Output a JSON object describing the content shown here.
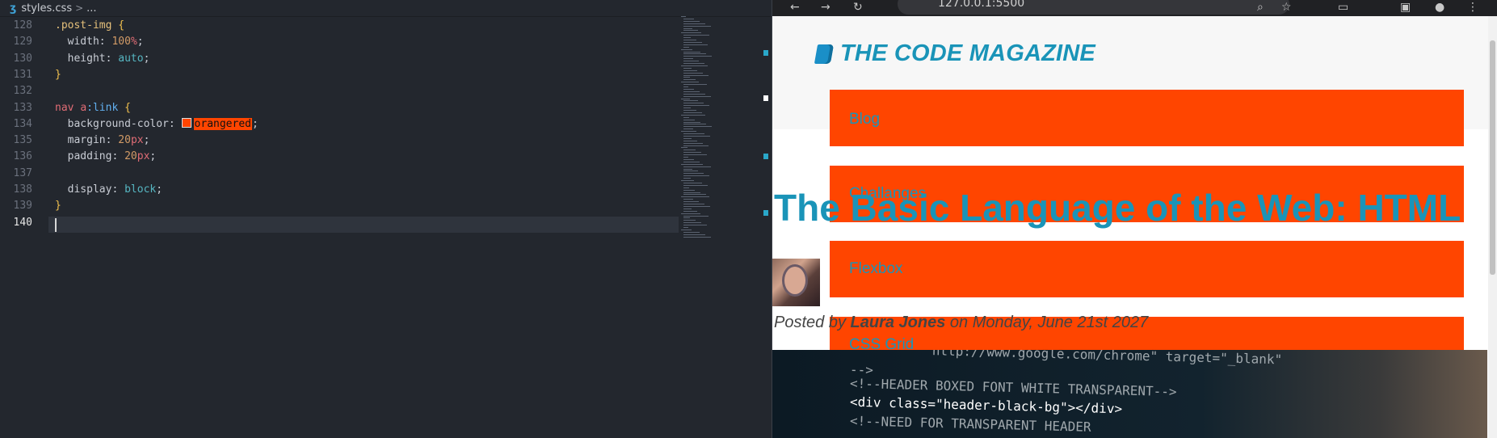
{
  "editor": {
    "breadcrumb": {
      "file": "styles.css",
      "more": "..."
    },
    "lines": [
      {
        "num": "128",
        "parts": [
          {
            "t": ".post-img",
            "c": "sel"
          },
          {
            "t": " ",
            "c": ""
          },
          {
            "t": "{",
            "c": "brace"
          }
        ]
      },
      {
        "num": "129",
        "parts": [
          {
            "t": "  width: ",
            "c": "prop"
          },
          {
            "t": "100",
            "c": "num"
          },
          {
            "t": "%",
            "c": "unit"
          },
          {
            "t": ";",
            "c": "prop"
          }
        ]
      },
      {
        "num": "130",
        "parts": [
          {
            "t": "  height: ",
            "c": "prop"
          },
          {
            "t": "auto",
            "c": "kw"
          },
          {
            "t": ";",
            "c": "prop"
          }
        ]
      },
      {
        "num": "131",
        "parts": [
          {
            "t": "}",
            "c": "brace"
          }
        ]
      },
      {
        "num": "132",
        "parts": []
      },
      {
        "num": "133",
        "parts": [
          {
            "t": "nav ",
            "c": "tag"
          },
          {
            "t": "a",
            "c": "tag"
          },
          {
            "t": ":link",
            "c": "pseudo"
          },
          {
            "t": " ",
            "c": ""
          },
          {
            "t": "{",
            "c": "brace"
          }
        ]
      },
      {
        "num": "134",
        "parts": [
          {
            "t": "  background-color: ",
            "c": "prop"
          },
          {
            "t": "",
            "c": "swatch"
          },
          {
            "t": "orangered",
            "c": "color-val"
          },
          {
            "t": ";",
            "c": "prop"
          }
        ]
      },
      {
        "num": "135",
        "parts": [
          {
            "t": "  margin: ",
            "c": "prop"
          },
          {
            "t": "20",
            "c": "num"
          },
          {
            "t": "px",
            "c": "unit"
          },
          {
            "t": ";",
            "c": "prop"
          }
        ]
      },
      {
        "num": "136",
        "parts": [
          {
            "t": "  padding: ",
            "c": "prop"
          },
          {
            "t": "20",
            "c": "num"
          },
          {
            "t": "px",
            "c": "unit"
          },
          {
            "t": ";",
            "c": "prop"
          }
        ]
      },
      {
        "num": "137",
        "parts": []
      },
      {
        "num": "138",
        "parts": [
          {
            "t": "  display: ",
            "c": "prop"
          },
          {
            "t": "block",
            "c": "kw"
          },
          {
            "t": ";",
            "c": "prop"
          }
        ]
      },
      {
        "num": "139",
        "parts": [
          {
            "t": "}",
            "c": "brace"
          }
        ]
      },
      {
        "num": "140",
        "parts": []
      }
    ],
    "active_line": "140"
  },
  "browser": {
    "address": "127.0.0.1:5500",
    "site_title": "THE CODE MAGAZINE",
    "nav": [
      "Blog",
      "Challanges",
      "Flexbox",
      "CSS Grid"
    ],
    "headline": "The Basic Language of the Web: HTML",
    "posted": {
      "prefix": "Posted by ",
      "author": "Laura Jones",
      "suffix": " on Monday, June 21st 2027"
    },
    "image_code": [
      "     \"http://www.google.com/chrome\" target=\"_blank\"",
      "-->",
      "<!--HEADER BOXED FONT WHITE TRANSPARENT-->",
      "<div class=\"header-black-bg\"></div>",
      "<!--NEED FOR TRANSPARENT HEADER"
    ]
  },
  "colors": {
    "accent": "#1a94b8",
    "nav_bg": "#ff4500",
    "editor_bg": "#23272e"
  }
}
